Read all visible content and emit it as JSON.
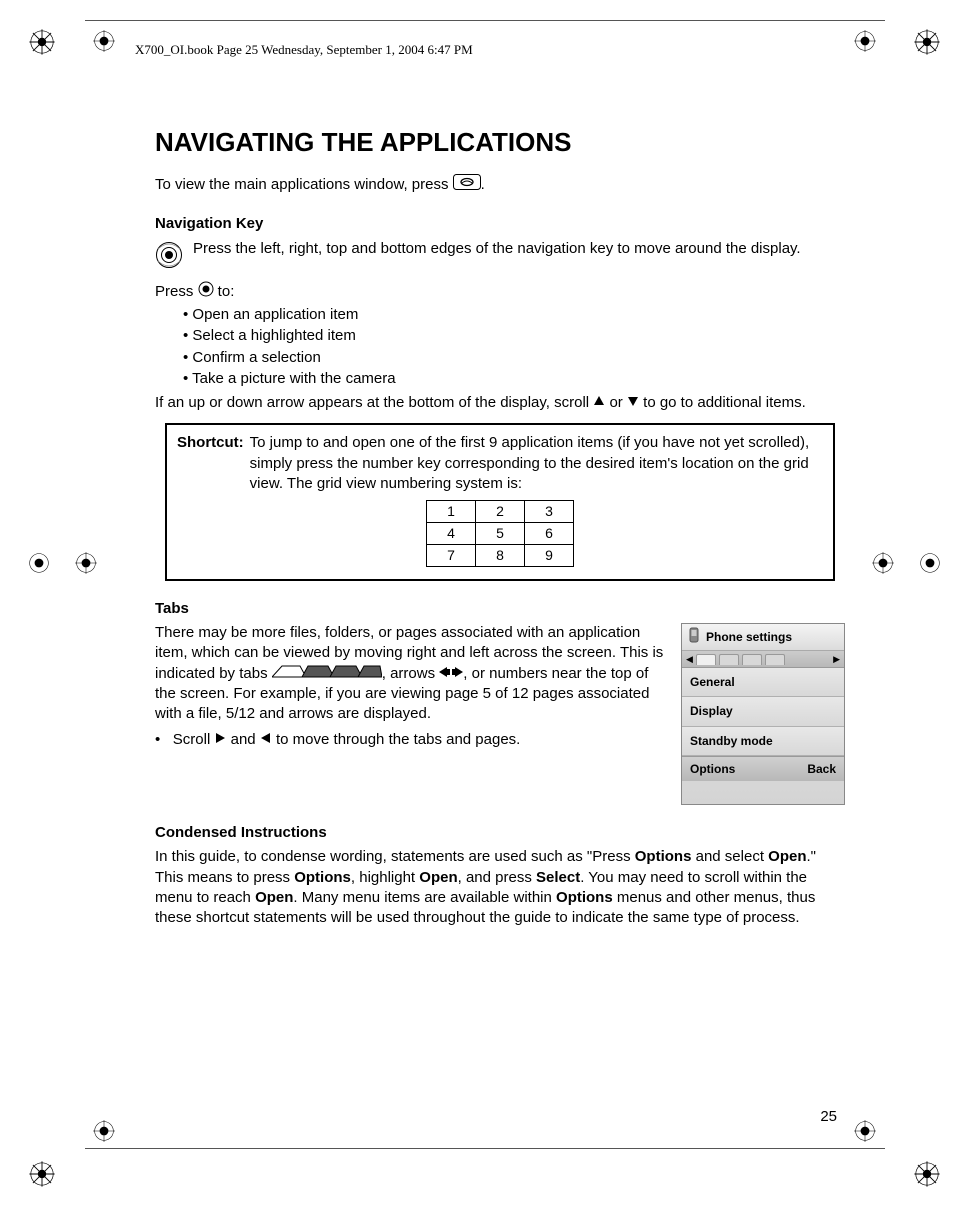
{
  "header": "X700_OI.book  Page 25  Wednesday, September 1, 2004  6:47 PM",
  "title": "NAVIGATING THE APPLICATIONS",
  "intro_a": "To view the main applications window, press ",
  "intro_b": ".",
  "nav_key": {
    "heading": "Navigation Key",
    "desc": "Press the left, right, top and bottom edges of the navigation key to move around the display.",
    "press_to_a": "Press ",
    "press_to_b": " to:",
    "items": [
      "Open an application item",
      "Select a highlighted item",
      "Confirm a selection",
      "Take a picture with the camera"
    ],
    "scroll_a": "If an up or down arrow appears at the bottom of the display, scroll ",
    "scroll_b": " or ",
    "scroll_c": " to go to additional items."
  },
  "shortcut": {
    "label": "Shortcut:",
    "text": "To jump to and open one of the first 9 application items (if you have not yet scrolled), simply press the number key corresponding to the desired item's location on the grid view. The grid view numbering system is:",
    "grid": [
      [
        "1",
        "2",
        "3"
      ],
      [
        "4",
        "5",
        "6"
      ],
      [
        "7",
        "8",
        "9"
      ]
    ]
  },
  "tabs": {
    "heading": "Tabs",
    "p1a": "There may be more files, folders, or pages associated with an application item, which can be viewed by moving right and left across the screen. This is indicated by tabs ",
    "p1b": ", arrows ",
    "p1c": ", or numbers near the top of the screen.  For example, if you are viewing page 5 of 12 pages associated with a file, 5/12 and arrows are displayed.",
    "bullet_a": "Scroll ",
    "bullet_b": " and ",
    "bullet_c": " to move through the tabs and pages."
  },
  "phone": {
    "title": "Phone settings",
    "items": [
      "General",
      "Display",
      "Standby mode"
    ],
    "soft_left": "Options",
    "soft_right": "Back"
  },
  "condensed": {
    "heading": "Condensed Instructions",
    "a": "In this guide, to condense wording, statements are used such as \"Press ",
    "b1": "Options",
    "c": " and select ",
    "b2": "Open",
    "d": ".\" This means to press ",
    "b3": "Options",
    "e": ", highlight ",
    "b4": "Open",
    "f": ", and press ",
    "b5": "Select",
    "g": ". You may need to scroll within the menu to reach ",
    "b6": "Open",
    "h": ". Many menu items are available within ",
    "b7": "Options",
    "i": " menus and other menus, thus these shortcut statements will be used throughout the guide to indicate the same type of process."
  },
  "page_number": "25"
}
